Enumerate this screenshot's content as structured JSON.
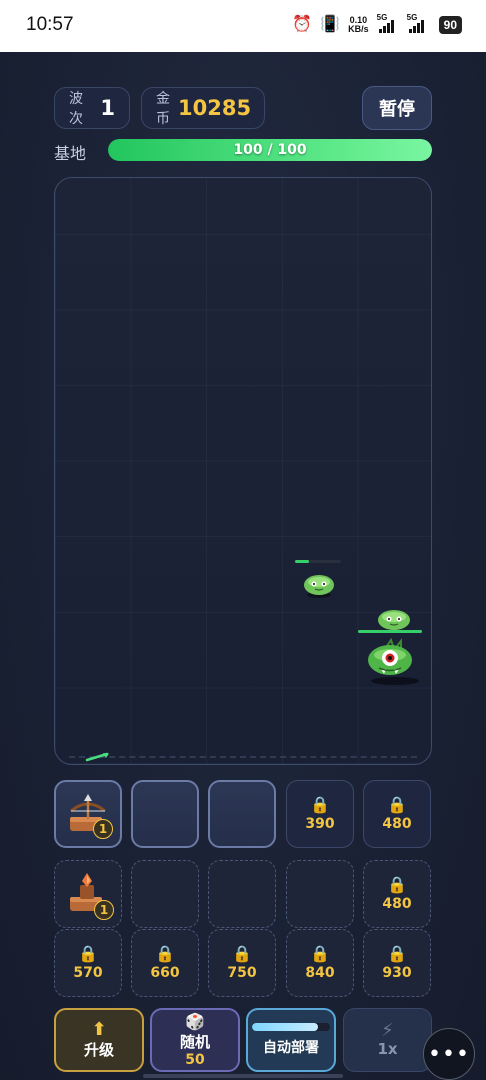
{
  "status_bar": {
    "time": "10:57",
    "net_speed_top": "0.10",
    "net_speed_unit": "KB/s",
    "sim1": "5G",
    "sim2": "5G",
    "battery": "90"
  },
  "header": {
    "wave_label": "波次",
    "wave_value": "1",
    "gold_label": "金币",
    "gold_value": "10285",
    "pause_label": "暂停"
  },
  "base": {
    "label": "基地",
    "hp_text": "100 / 100",
    "hp_fraction": 1.0
  },
  "enemies": [
    {
      "type": "small-slime",
      "hp_fraction": 0.3
    },
    {
      "type": "small-slime",
      "hp_fraction": 1.0
    },
    {
      "type": "one-eyed-monster"
    }
  ],
  "slots_row1": [
    {
      "unit": "crossbow-icon",
      "level": "1"
    },
    {
      "empty": true
    },
    {
      "empty": true
    },
    {
      "cost": "390",
      "locked": true
    },
    {
      "cost": "480",
      "locked": true
    }
  ],
  "slots_row2": [
    {
      "unit": "cannon-icon",
      "level": "1"
    },
    {
      "empty": true
    },
    {
      "empty": true
    },
    {
      "empty": true
    },
    {
      "cost": "480",
      "locked": true
    }
  ],
  "slots_row3": [
    {
      "cost": "570",
      "locked": true
    },
    {
      "cost": "660",
      "locked": true
    },
    {
      "cost": "750",
      "locked": true
    },
    {
      "cost": "840",
      "locked": true
    },
    {
      "cost": "930",
      "locked": true
    }
  ],
  "actions": {
    "upgrade_label": "升级",
    "random_label": "随机",
    "random_cost": "50",
    "auto_label": "自动部署",
    "auto_progress": 0.85,
    "speed_label": "1x"
  },
  "colors": {
    "gold": "#f4c542",
    "hp_green": "#22c55e",
    "background": "#1b2235"
  }
}
